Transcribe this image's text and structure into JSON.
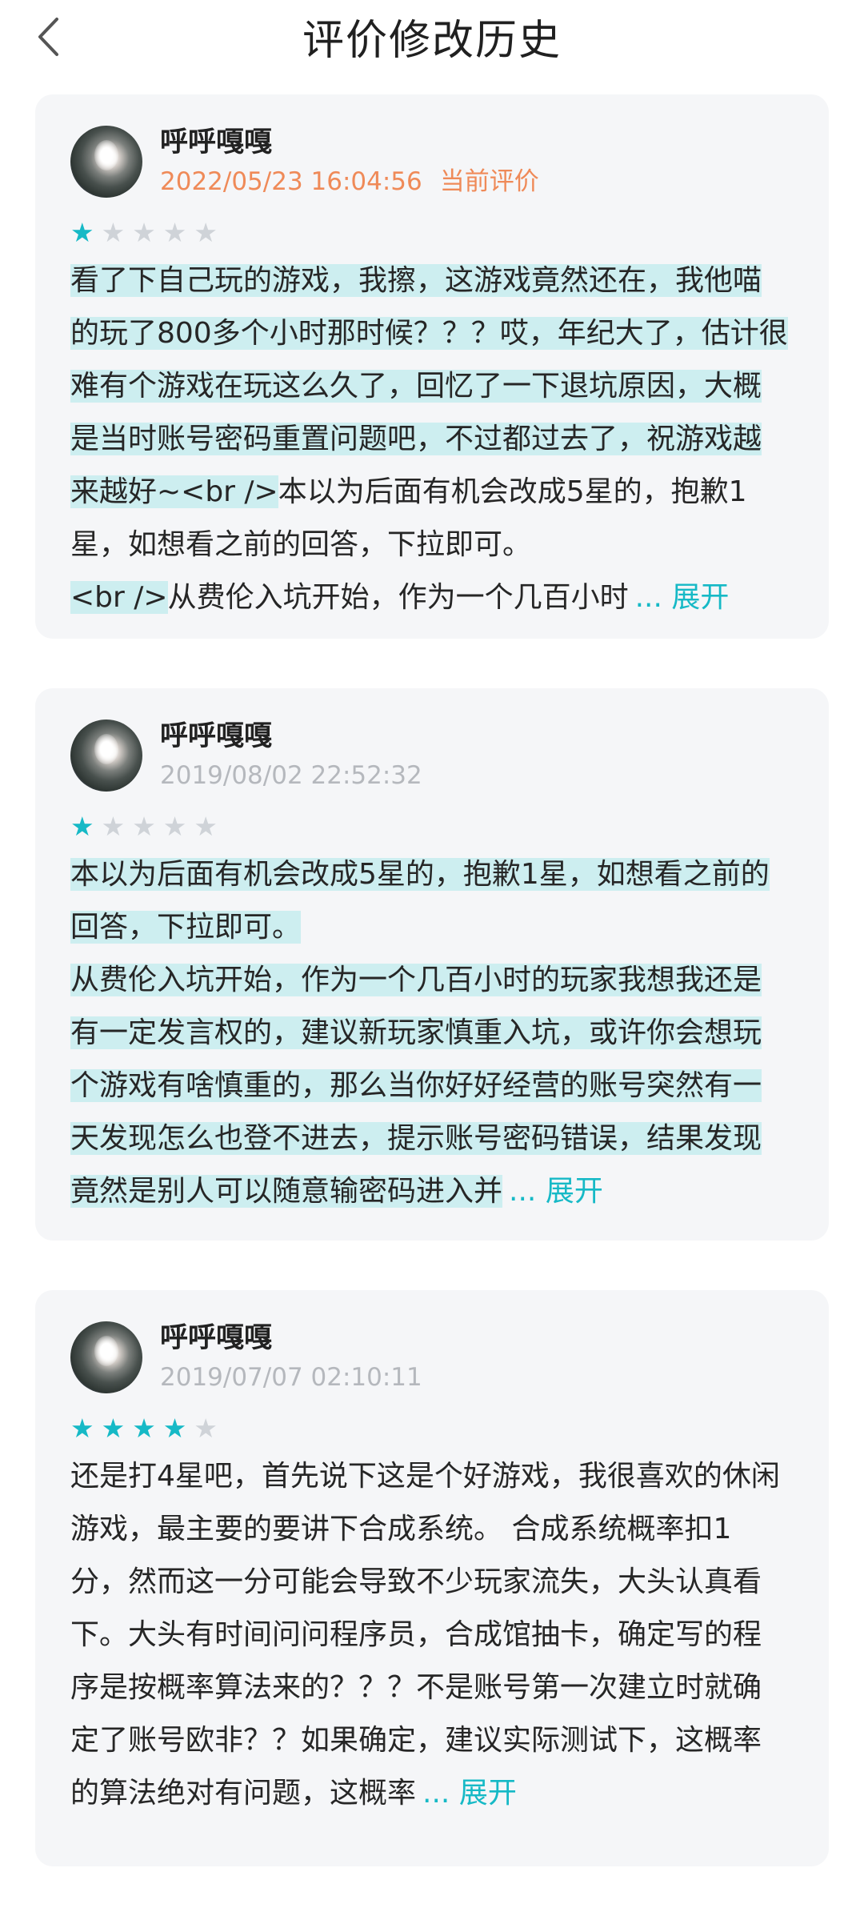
{
  "header": {
    "title": "评价修改历史"
  },
  "colors": {
    "accent": "#16b9c6",
    "current_timestamp": "#ef8a58",
    "highlight": "#cdeef0",
    "card_bg": "#f5f6f8"
  },
  "reviews": [
    {
      "username": "呼呼嘎嘎",
      "timestamp": "2022/05/23 16:04:56",
      "current_label": "当前评价",
      "rating": 1,
      "rating_max": 5,
      "body_highlight": "看了下自己玩的游戏，我擦，这游戏竟然还在，我他喵的玩了800多个小时那时候？？？哎，年纪大了，估计很难有个游戏在玩这么久了，回忆了一下退坑原因，大概是当时账号密码重置问题吧，不过都过去了，祝游戏越来越好~<br />",
      "body_plain": "本以为后面有机会改成5星的，抱歉1星，如想看之前的回答，下拉即可。",
      "body_tail_highlight": "<br />",
      "body_tail_plain": "从费伦入坑开始，作为一个几百小时",
      "ellipsis": "...",
      "expand_label": "展开"
    },
    {
      "username": "呼呼嘎嘎",
      "timestamp": "2019/08/02 22:52:32",
      "rating": 1,
      "rating_max": 5,
      "body_line1": "本以为后面有机会改成5星的，抱歉1星，如想看之前的回答，下拉即可。",
      "body_line2": "从费伦入坑开始，作为一个几百小时的玩家我想我还是有一定发言权的，建议新玩家慎重入坑，或许你会想玩个游戏有啥慎重的，那么当你好好经营的账号突然有一天发现怎么也登不进去，提示账号密码错误，结果发现竟然是别人可以随意输密码进入并",
      "ellipsis": "...",
      "expand_label": "展开"
    },
    {
      "username": "呼呼嘎嘎",
      "timestamp": "2019/07/07 02:10:11",
      "rating": 4,
      "rating_max": 5,
      "body": "还是打4星吧，首先说下这是个好游戏，我很喜欢的休闲游戏，最主要的要讲下合成系统。 合成系统概率扣1分，然而这一分可能会导致不少玩家流失，大头认真看下。大头有时间问问程序员，合成馆抽卡，确定写的程序是按概率算法来的？？？不是账号第一次建立时就确定了账号欧非？？如果确定，建议实际测试下，这概率的算法绝对有问题，这概率",
      "ellipsis": "...",
      "expand_label": "展开"
    }
  ]
}
